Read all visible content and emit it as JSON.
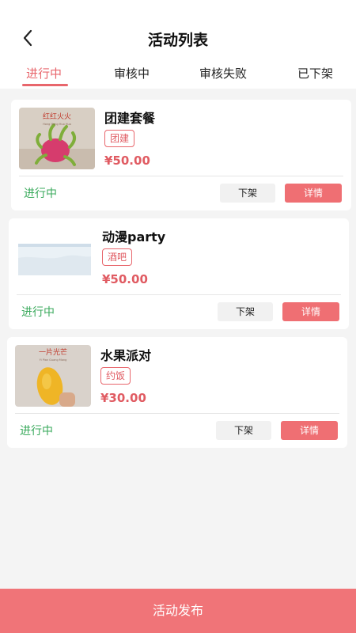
{
  "header": {
    "title": "活动列表",
    "back_icon": "chevron-left-icon"
  },
  "tabs": [
    {
      "label": "进行中",
      "active": true
    },
    {
      "label": "审核中",
      "active": false
    },
    {
      "label": "审核失败",
      "active": false
    },
    {
      "label": "已下架",
      "active": false
    }
  ],
  "colors": {
    "accent": "#e8666c",
    "status_green": "#3aaa5c",
    "button_red": "#ef6f73"
  },
  "activities": [
    {
      "title": "团建套餐",
      "tag": "团建",
      "price": "¥50.00",
      "status": "进行中",
      "off_label": "下架",
      "detail_label": "详情",
      "image_text": "红红火火",
      "image_subtext": "Hong Hong Huo Huo"
    },
    {
      "title": "动漫party",
      "tag": "酒吧",
      "price": "¥50.00",
      "status": "进行中",
      "off_label": "下架",
      "detail_label": "详情"
    },
    {
      "title": "水果派对",
      "tag": "约饭",
      "price": "¥30.00",
      "status": "进行中",
      "off_label": "下架",
      "detail_label": "详情",
      "image_text": "一片光芒",
      "image_subtext": "Yi Pian Guang Mang"
    }
  ],
  "footer": {
    "publish_label": "活动发布"
  }
}
